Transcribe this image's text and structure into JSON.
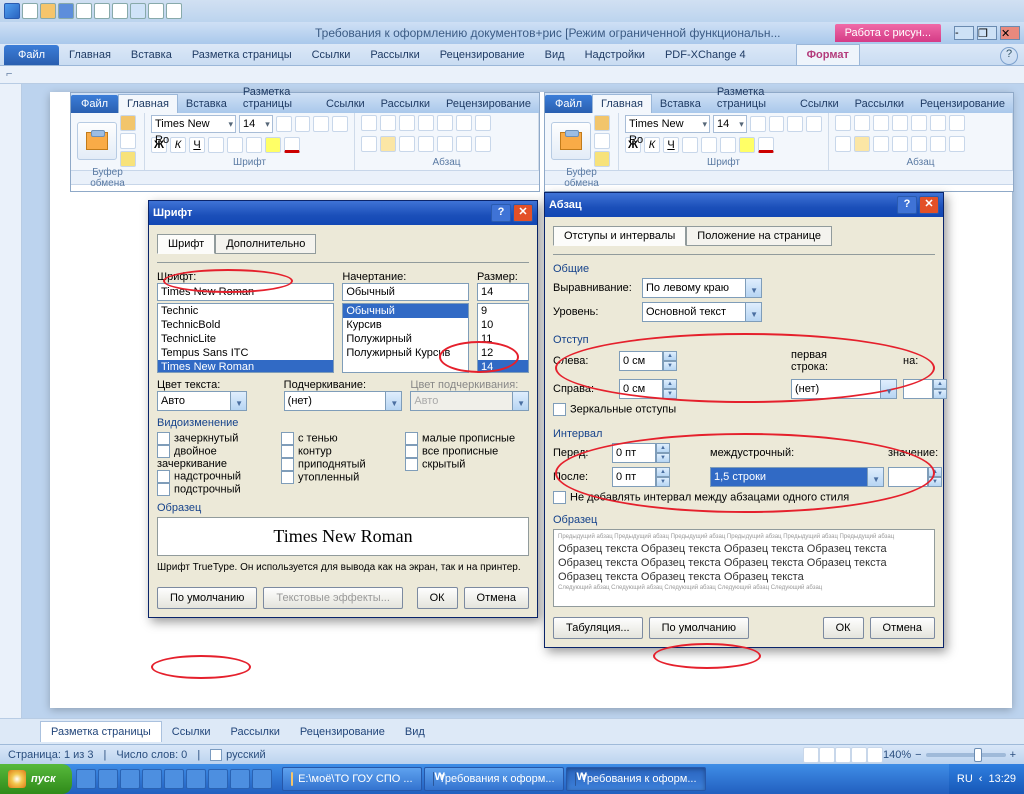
{
  "app": {
    "title": "Требования к оформлению документов+рис [Режим ограниченной функциональн...",
    "contextTab": "Работа с рисун..."
  },
  "mainTabs": {
    "file": "Файл",
    "items": [
      "Главная",
      "Вставка",
      "Разметка страницы",
      "Ссылки",
      "Рассылки",
      "Рецензирование",
      "Вид",
      "Надстройки",
      "PDF-XChange 4"
    ],
    "ctx": "Формат"
  },
  "emb": {
    "file": "Файл",
    "tabs": [
      "Главная",
      "Вставка",
      "Разметка страницы",
      "Ссылки",
      "Рассылки",
      "Рецензирование"
    ],
    "paste": "Вставить",
    "clipGroup": "Буфер обмена",
    "fontGroup": "Шрифт",
    "paraGroup": "Абзац",
    "fontName": "Times New Ro",
    "fontSize": "14"
  },
  "bottomTabs": [
    "Разметка страницы",
    "Ссылки",
    "Рассылки",
    "Рецензирование",
    "Вид"
  ],
  "fontDlg": {
    "title": "Шрифт",
    "tabs": [
      "Шрифт",
      "Дополнительно"
    ],
    "lblFont": "Шрифт:",
    "lblStyle": "Начертание:",
    "lblSize": "Размер:",
    "fontVal": "Times New Roman",
    "styleVal": "Обычный",
    "sizeVal": "14",
    "fontList": [
      "Technic",
      "TechnicBold",
      "TechnicLite",
      "Tempus Sans ITC",
      "Times New Roman"
    ],
    "styleList": [
      "Обычный",
      "Курсив",
      "Полужирный",
      "Полужирный Курсив"
    ],
    "sizeList": [
      "9",
      "10",
      "11",
      "12",
      "14"
    ],
    "lblColor": "Цвет текста:",
    "lblUnder": "Подчеркивание:",
    "lblUColor": "Цвет подчеркивания:",
    "colorVal": "Авто",
    "underVal": "(нет)",
    "uColorVal": "Авто",
    "effects": "Видоизменение",
    "e": [
      "зачеркнутый",
      "двойное зачеркивание",
      "надстрочный",
      "подстрочный",
      "с тенью",
      "контур",
      "приподнятый",
      "утопленный",
      "малые прописные",
      "все прописные",
      "скрытый"
    ],
    "sample": "Образец",
    "sampleText": "Times New Roman",
    "hint": "Шрифт TrueType. Он используется для вывода как на экран, так и на принтер.",
    "default": "По умолчанию",
    "textfx": "Текстовые эффекты...",
    "ok": "ОК",
    "cancel": "Отмена"
  },
  "paraDlg": {
    "title": "Абзац",
    "tabs": [
      "Отступы и интервалы",
      "Положение на странице"
    ],
    "common": "Общие",
    "align": "Выравнивание:",
    "alignVal": "По левому краю",
    "level": "Уровень:",
    "levelVal": "Основной текст",
    "indent": "Отступ",
    "left": "Слева:",
    "leftVal": "0 см",
    "right": "Справа:",
    "rightVal": "0 см",
    "first": "первая строка:",
    "firstVal": "(нет)",
    "on": "на:",
    "onVal": "",
    "mirror": "Зеркальные отступы",
    "spacing": "Интервал",
    "before": "Перед:",
    "beforeVal": "0 пт",
    "after": "После:",
    "afterVal": "0 пт",
    "line": "междустрочный:",
    "lineVal": "1,5 строки",
    "val": "значение:",
    "valVal": "",
    "noSpace": "Не добавлять интервал между абзацами одного стиля",
    "sample": "Образец",
    "tabBtn": "Табуляция...",
    "default": "По умолчанию",
    "ok": "ОК",
    "cancel": "Отмена"
  },
  "status": {
    "page": "Страница: 1 из 3",
    "words": "Число слов: 0",
    "lang": "русский",
    "zoom": "140%"
  },
  "taskbar": {
    "start": "пуск",
    "tasks": [
      {
        "label": "Е:\\моё\\ТО ГОУ СПО ...",
        "word": false
      },
      {
        "label": "Требования к оформ...",
        "word": true,
        "active": false
      },
      {
        "label": "Требования к оформ...",
        "word": true,
        "active": true
      }
    ],
    "lang": "RU",
    "time": "13:29"
  }
}
